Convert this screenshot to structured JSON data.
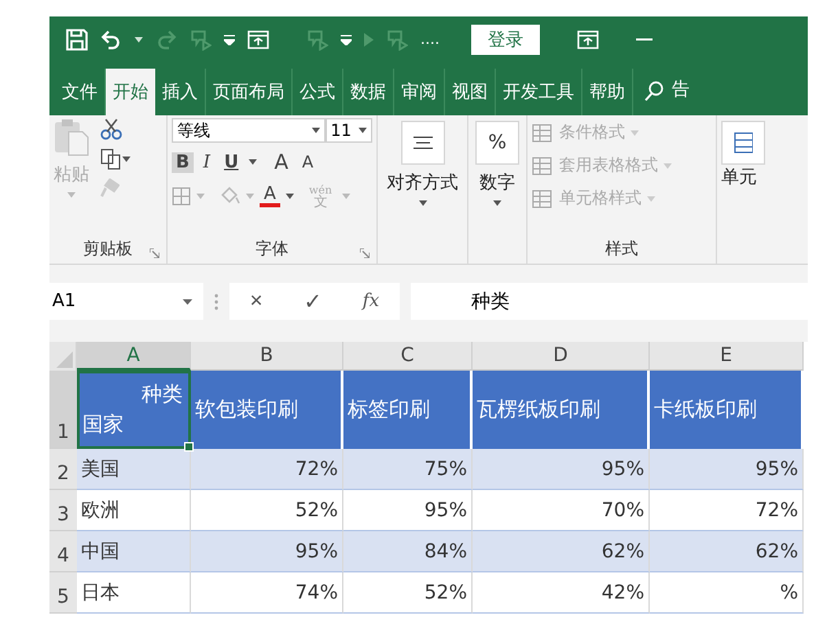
{
  "quick_access": {
    "more": "....",
    "login_button": "登录"
  },
  "tabs": [
    {
      "label": "文件",
      "selected": false
    },
    {
      "label": "开始",
      "selected": true
    },
    {
      "label": "插入",
      "selected": false
    },
    {
      "label": "页面布局",
      "selected": false
    },
    {
      "label": "公式",
      "selected": false
    },
    {
      "label": "数据",
      "selected": false
    },
    {
      "label": "审阅",
      "selected": false
    },
    {
      "label": "视图",
      "selected": false
    },
    {
      "label": "开发工具",
      "selected": false
    },
    {
      "label": "帮助",
      "selected": false
    }
  ],
  "tell_me": "告",
  "ribbon": {
    "clipboard": {
      "paste": "粘贴",
      "label": "剪贴板"
    },
    "font": {
      "name": "等线",
      "size": "11",
      "bold": "B",
      "italic": "I",
      "underline": "U",
      "grow": "A",
      "shrink": "A",
      "font_color": "A",
      "phonetic_top": "wén",
      "phonetic_bottom": "文",
      "label": "字体"
    },
    "alignment": {
      "label": "对齐方式"
    },
    "number": {
      "symbol": "%",
      "label": "数字"
    },
    "styles": {
      "items": [
        "条件格式",
        "套用表格格式",
        "单元格样式"
      ],
      "label": "样式"
    },
    "cells": {
      "label": "单元"
    }
  },
  "formula_bar": {
    "name_box": "A1",
    "cancel": "×",
    "enter": "✓",
    "fx": "fx",
    "value": "种类"
  },
  "sheet": {
    "columns": [
      {
        "label": "A",
        "selected": true
      },
      {
        "label": "B",
        "selected": false
      },
      {
        "label": "C",
        "selected": false
      },
      {
        "label": "D",
        "selected": false
      },
      {
        "label": "E",
        "selected": false
      }
    ],
    "rows": [
      {
        "number": "1",
        "selected": true
      },
      {
        "number": "2",
        "selected": false
      },
      {
        "number": "3",
        "selected": false
      },
      {
        "number": "4",
        "selected": false
      },
      {
        "number": "5",
        "selected": false
      }
    ],
    "header": {
      "corner_top": "种类",
      "corner_bottom": "国家",
      "categories": [
        "软包装印刷",
        "标签印刷",
        "瓦楞纸板印刷",
        "卡纸板印刷"
      ]
    },
    "data": [
      {
        "country": "美国",
        "values": [
          "72%",
          "75%",
          "95%",
          "95%"
        ]
      },
      {
        "country": "欧洲",
        "values": [
          "52%",
          "95%",
          "70%",
          "72%"
        ]
      },
      {
        "country": "中国",
        "values": [
          "95%",
          "84%",
          "62%",
          "62%"
        ]
      },
      {
        "country": "日本",
        "values": [
          "74%",
          "52%",
          "42%",
          "%"
        ]
      }
    ]
  }
}
